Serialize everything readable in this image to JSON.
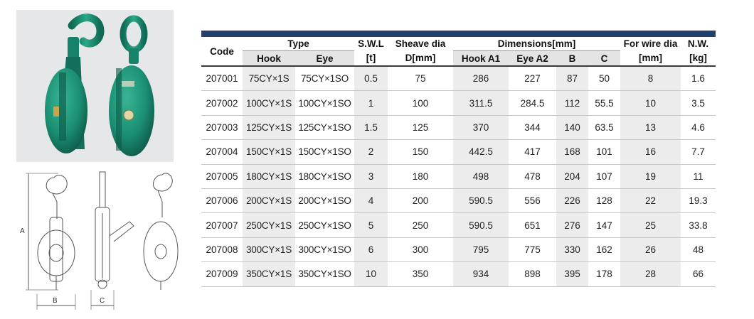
{
  "table": {
    "headers": {
      "code": "Code",
      "type": "Type",
      "hook": "Hook",
      "eye": "Eye",
      "swl_line1": "S.W.L",
      "swl_line2": "[t]",
      "sheave_line1": "Sheave dia",
      "sheave_line2": "D[mm]",
      "dimensions": "Dimensions[mm]",
      "hook_a1": "Hook A1",
      "eye_a2": "Eye A2",
      "b": "B",
      "c": "C",
      "wire_line1": "For wire dia",
      "wire_line2": "[mm]",
      "nw_line1": "N.W.",
      "nw_line2": "[kg]"
    },
    "rows": [
      {
        "code": "207001",
        "hook": "75CY×1S",
        "eye": "75CY×1SO",
        "swl": "0.5",
        "sheave": "75",
        "a1": "286",
        "a2": "227",
        "b": "87",
        "c": "50",
        "wire": "8",
        "nw": "1.6"
      },
      {
        "code": "207002",
        "hook": "100CY×1S",
        "eye": "100CY×1SO",
        "swl": "1",
        "sheave": "100",
        "a1": "311.5",
        "a2": "284.5",
        "b": "112",
        "c": "55.5",
        "wire": "10",
        "nw": "3.5"
      },
      {
        "code": "207003",
        "hook": "125CY×1S",
        "eye": "125CY×1SO",
        "swl": "1.5",
        "sheave": "125",
        "a1": "370",
        "a2": "344",
        "b": "140",
        "c": "63.5",
        "wire": "13",
        "nw": "4.6"
      },
      {
        "code": "207004",
        "hook": "150CY×1S",
        "eye": "150CY×1SO",
        "swl": "2",
        "sheave": "150",
        "a1": "442.5",
        "a2": "417",
        "b": "168",
        "c": "101",
        "wire": "16",
        "nw": "7.7"
      },
      {
        "code": "207005",
        "hook": "180CY×1S",
        "eye": "180CY×1SO",
        "swl": "3",
        "sheave": "180",
        "a1": "498",
        "a2": "478",
        "b": "204",
        "c": "107",
        "wire": "19",
        "nw": "11"
      },
      {
        "code": "207006",
        "hook": "200CY×1S",
        "eye": "200CY×1SO",
        "swl": "4",
        "sheave": "200",
        "a1": "590.5",
        "a2": "556",
        "b": "226",
        "c": "128",
        "wire": "22",
        "nw": "19.3"
      },
      {
        "code": "207007",
        "hook": "250CY×1S",
        "eye": "250CY×1SO",
        "swl": "5",
        "sheave": "250",
        "a1": "590.5",
        "a2": "651",
        "b": "276",
        "c": "147",
        "wire": "25",
        "nw": "33.8"
      },
      {
        "code": "207008",
        "hook": "300CY×1S",
        "eye": "300CY×1SO",
        "swl": "6",
        "sheave": "300",
        "a1": "795",
        "a2": "775",
        "b": "330",
        "c": "162",
        "wire": "26",
        "nw": "48"
      },
      {
        "code": "207009",
        "hook": "350CY×1S",
        "eye": "350CY×1SO",
        "swl": "10",
        "sheave": "350",
        "a1": "934",
        "a2": "898",
        "b": "395",
        "c": "178",
        "wire": "28",
        "nw": "66"
      }
    ]
  },
  "drawing_labels": {
    "a": "A",
    "b": "B",
    "c": "C"
  },
  "colors": {
    "header_bar": "#22406e",
    "product_green": "#1b8f73",
    "shade": "#ececec"
  }
}
